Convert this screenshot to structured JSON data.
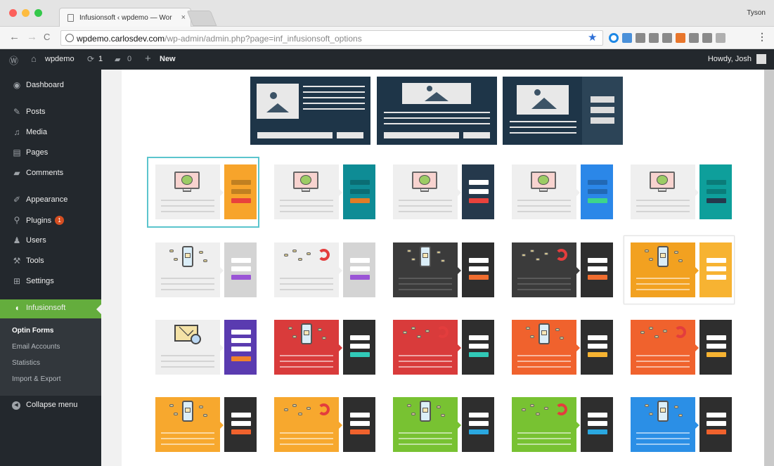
{
  "browser": {
    "tab_title": "Infusionsoft ‹ wpdemo — Wor",
    "tab_close": "×",
    "profile_name": "Tyson",
    "url_host": "wpdemo.carlosdev.com",
    "url_path": "/wp-admin/admin.php?page=inf_infusionsoft_options",
    "nav_back": "←",
    "nav_forward": "→",
    "nav_reload": "C",
    "star_icon": "★",
    "menu_icon": "⋮",
    "traffic_lights": [
      "#fc605b",
      "#fdbc40",
      "#34c84a"
    ],
    "extension_colors": [
      "#1e88e5",
      "#4a90d9",
      "#8a8a8a",
      "#8a8a8a",
      "#8a8a8a",
      "#e8762c",
      "#8a8a8a",
      "#8a8a8a",
      "#b0b0b0"
    ]
  },
  "admin_bar": {
    "wp_logo": "Ⓦ",
    "site_icon": "⌂",
    "site_name": "wpdemo",
    "updates_icon": "⟳",
    "updates_count": "1",
    "comments_icon": "▰",
    "comments_count": "0",
    "new_icon": "+",
    "new_label": "New",
    "howdy": "Howdy, Josh"
  },
  "sidebar": {
    "items": [
      {
        "icon": "◉",
        "label": "Dashboard"
      },
      {
        "icon": "✎",
        "label": "Posts"
      },
      {
        "icon": "♫",
        "label": "Media"
      },
      {
        "icon": "▤",
        "label": "Pages"
      },
      {
        "icon": "▰",
        "label": "Comments"
      },
      {
        "icon": "✐",
        "label": "Appearance"
      },
      {
        "icon": "⚲",
        "label": "Plugins",
        "badge": "1"
      },
      {
        "icon": "♟",
        "label": "Users"
      },
      {
        "icon": "⚒",
        "label": "Tools"
      },
      {
        "icon": "⊞",
        "label": "Settings"
      },
      {
        "icon": "◖",
        "label": "Infusionsoft"
      }
    ],
    "submenu": [
      "Optin Forms",
      "Email Accounts",
      "Statistics",
      "Import & Export"
    ],
    "collapse_icon": "◀",
    "collapse_label": "Collapse menu"
  },
  "theme": {
    "layout_bg": "#1e3548",
    "selected_border": "#5bc5cd",
    "wp_green": "#64ad3d"
  },
  "templates": [
    {
      "row": 0,
      "col": 0,
      "left": "#efefef",
      "right": "#f7a42b",
      "btn": "#e8423c",
      "art": "monitor",
      "state": "selected"
    },
    {
      "row": 0,
      "col": 1,
      "left": "#efefef",
      "right": "#0e8c95",
      "btn": "#e07c26",
      "art": "monitor"
    },
    {
      "row": 0,
      "col": 2,
      "left": "#efefef",
      "right": "#25394c",
      "btn": "#e8423c",
      "art": "monitor"
    },
    {
      "row": 0,
      "col": 3,
      "left": "#efefef",
      "right": "#2b87e8",
      "btn": "#3dd58b",
      "art": "monitor"
    },
    {
      "row": 0,
      "col": 4,
      "left": "#efefef",
      "right": "#0e9f9b",
      "btn": "#25394c",
      "art": "monitor"
    },
    {
      "row": 1,
      "col": 0,
      "left": "#efefef",
      "right": "#d4d4d4",
      "btn": "#9a55d6",
      "art": "phone"
    },
    {
      "row": 1,
      "col": 1,
      "left": "#efefef",
      "right": "#d4d4d4",
      "btn": "#9a55d6",
      "art": "magnet"
    },
    {
      "row": 1,
      "col": 2,
      "left": "#3b3b3b",
      "right": "#2e2e2e",
      "btn": "#f06d2f",
      "art": "phone"
    },
    {
      "row": 1,
      "col": 3,
      "left": "#3b3b3b",
      "right": "#2e2e2e",
      "btn": "#f06d2f",
      "art": "magnet"
    },
    {
      "row": 1,
      "col": 4,
      "left": "#f2a120",
      "right": "#f7b332",
      "btn": "#ffffff",
      "art": "phone",
      "state": "hover"
    },
    {
      "row": 2,
      "col": 0,
      "left": "#efefef",
      "right": "#5a3bb0",
      "btn": "#f0822b",
      "art": "envelope"
    },
    {
      "row": 2,
      "col": 1,
      "left": "#d93b3b",
      "right": "#2e2e2e",
      "btn": "#31c9b7",
      "art": "phone"
    },
    {
      "row": 2,
      "col": 2,
      "left": "#d93b3b",
      "right": "#2e2e2e",
      "btn": "#31c9b7",
      "art": "magnet"
    },
    {
      "row": 2,
      "col": 3,
      "left": "#f0622d",
      "right": "#2e2e2e",
      "btn": "#f7b332",
      "art": "phone"
    },
    {
      "row": 2,
      "col": 4,
      "left": "#f0622d",
      "right": "#2e2e2e",
      "btn": "#f7b332",
      "art": "magnet"
    },
    {
      "row": 3,
      "col": 0,
      "left": "#f7a82e",
      "right": "#2e2e2e",
      "btn": "#f0622d",
      "art": "phone"
    },
    {
      "row": 3,
      "col": 1,
      "left": "#f7a82e",
      "right": "#2e2e2e",
      "btn": "#f0622d",
      "art": "magnet"
    },
    {
      "row": 3,
      "col": 2,
      "left": "#78c232",
      "right": "#2e2e2e",
      "btn": "#2aa8e0",
      "art": "phone"
    },
    {
      "row": 3,
      "col": 3,
      "left": "#78c232",
      "right": "#2e2e2e",
      "btn": "#2aa8e0",
      "art": "magnet"
    },
    {
      "row": 3,
      "col": 4,
      "left": "#2b8fe6",
      "right": "#2e2e2e",
      "btn": "#f0622d",
      "art": "phone"
    }
  ]
}
